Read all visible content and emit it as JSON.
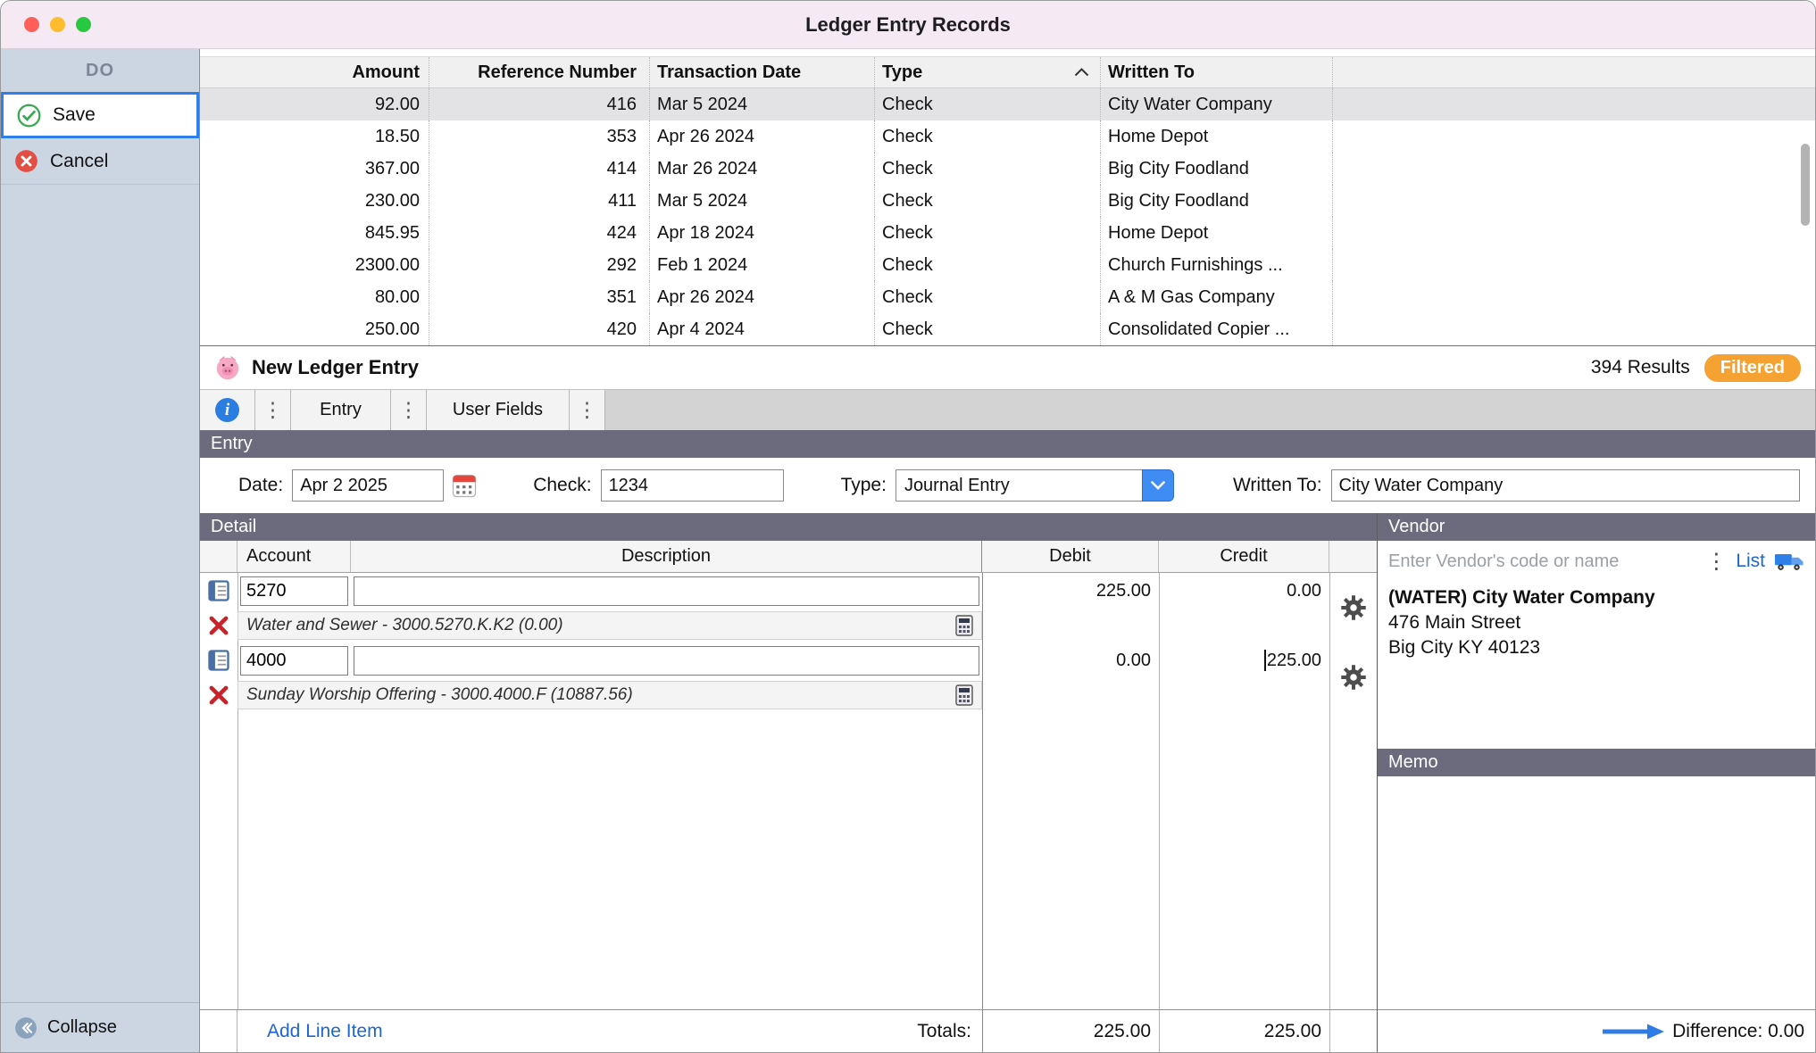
{
  "window": {
    "title": "Ledger Entry Records"
  },
  "sidebar": {
    "header": "DO",
    "save_label": "Save",
    "cancel_label": "Cancel",
    "collapse_label": "Collapse"
  },
  "records": {
    "columns": [
      "Amount",
      "Reference Number",
      "Transaction Date",
      "Type",
      "Written To"
    ],
    "rows": [
      {
        "amount": "92.00",
        "ref": "416",
        "date": "Mar 5 2024",
        "type": "Check",
        "written_to": "City Water Company"
      },
      {
        "amount": "18.50",
        "ref": "353",
        "date": "Apr 26 2024",
        "type": "Check",
        "written_to": "Home Depot"
      },
      {
        "amount": "367.00",
        "ref": "414",
        "date": "Mar 26 2024",
        "type": "Check",
        "written_to": "Big City Foodland"
      },
      {
        "amount": "230.00",
        "ref": "411",
        "date": "Mar 5 2024",
        "type": "Check",
        "written_to": "Big City Foodland"
      },
      {
        "amount": "845.95",
        "ref": "424",
        "date": "Apr 18 2024",
        "type": "Check",
        "written_to": "Home Depot"
      },
      {
        "amount": "2300.00",
        "ref": "292",
        "date": "Feb 1 2024",
        "type": "Check",
        "written_to": "Church Furnishings ..."
      },
      {
        "amount": "80.00",
        "ref": "351",
        "date": "Apr 26 2024",
        "type": "Check",
        "written_to": "A & M Gas Company"
      },
      {
        "amount": "250.00",
        "ref": "420",
        "date": "Apr 4 2024",
        "type": "Check",
        "written_to": "Consolidated Copier ..."
      }
    ]
  },
  "entry_bar": {
    "title": "New Ledger Entry",
    "results": "394 Results",
    "filtered_label": "Filtered"
  },
  "tabs": {
    "entry": "Entry",
    "user_fields": "User Fields"
  },
  "entry_form": {
    "section_title": "Entry",
    "date_label": "Date:",
    "date_value": "Apr 2 2025",
    "check_label": "Check:",
    "check_value": "1234",
    "type_label": "Type:",
    "type_value": "Journal Entry",
    "written_to_label": "Written To:",
    "written_to_value": "City Water Company"
  },
  "detail": {
    "section_title": "Detail",
    "columns": [
      "Account",
      "Description",
      "Debit",
      "Credit"
    ],
    "rows": [
      {
        "account": "5270",
        "description": "",
        "debit": "225.00",
        "credit": "0.00",
        "account_info": "Water and Sewer - 3000.5270.K.K2 (0.00)"
      },
      {
        "account": "4000",
        "description": "",
        "debit": "0.00",
        "credit": "225.00",
        "account_info": "Sunday Worship Offering - 3000.4000.F (10887.56)"
      }
    ],
    "add_line_label": "Add Line Item",
    "totals_label": "Totals:",
    "total_debit": "225.00",
    "total_credit": "225.00"
  },
  "vendor": {
    "section_title": "Vendor",
    "search_placeholder": "Enter Vendor's code or name",
    "list_label": "List",
    "name": "(WATER) City Water Company",
    "address1": "476 Main Street",
    "address2": "Big City KY 40123"
  },
  "memo": {
    "section_title": "Memo"
  },
  "footer": {
    "difference_label": "Difference: 0.00"
  },
  "colors": {
    "accent_blue": "#2f80e8",
    "filtered_orange": "#f5a233",
    "section_slate": "#6b6b7d"
  }
}
